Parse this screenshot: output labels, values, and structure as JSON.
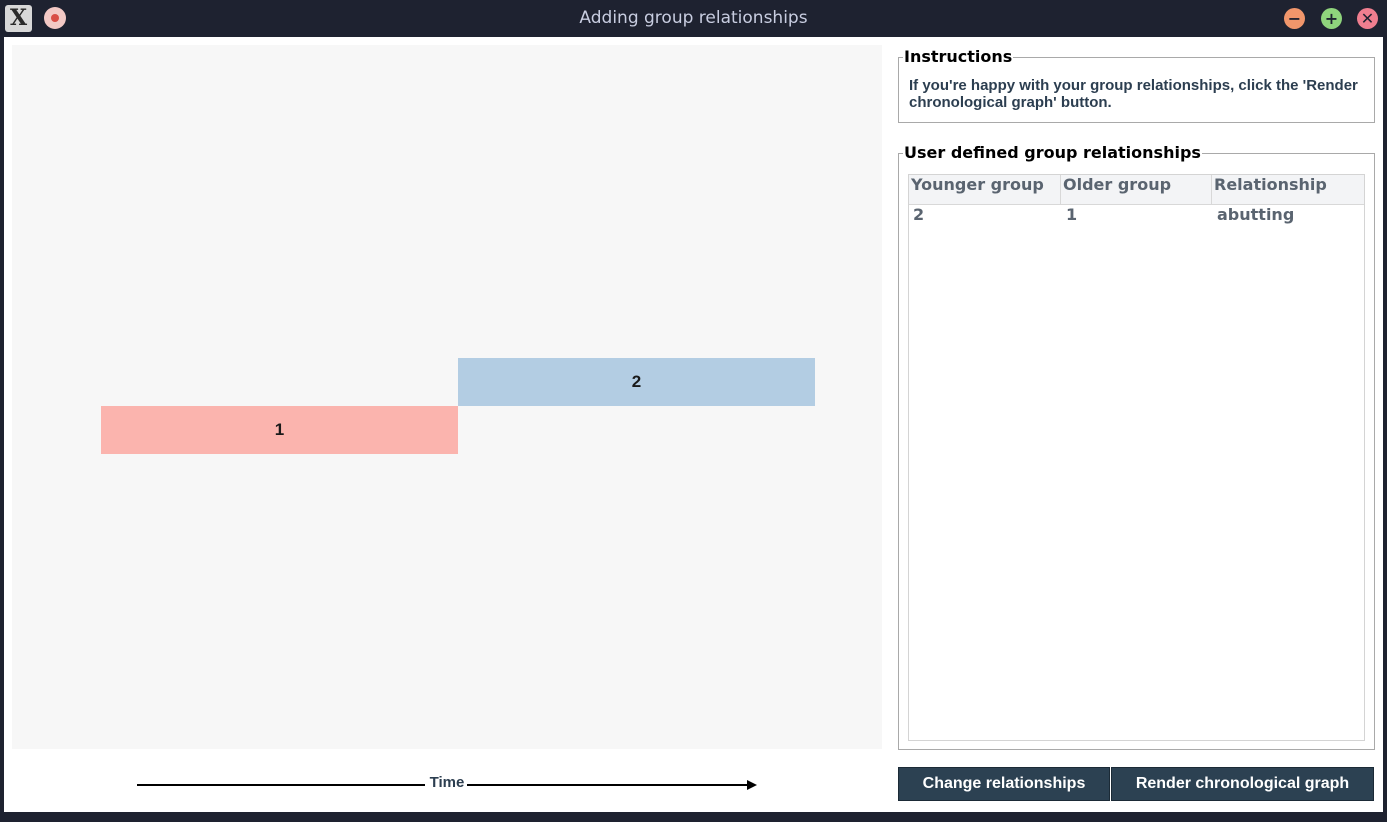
{
  "window": {
    "title": "Adding group relationships"
  },
  "titlebar": {
    "app_icon": "x-app-icon",
    "pin_icon": "pin-icon",
    "minimize_symbol": "−",
    "maximize_symbol": "+",
    "close_symbol": "✕"
  },
  "canvas": {
    "groups": [
      {
        "label": "1",
        "color": "#fbb4ae"
      },
      {
        "label": "2",
        "color": "#b3cde3"
      }
    ],
    "axis_label": "Time"
  },
  "instructions": {
    "title": "Instructions",
    "text": "If you're happy with your group relationships, click the 'Render chronological graph' button."
  },
  "relationships": {
    "title": "User defined group relationships",
    "columns": [
      "Younger group",
      "Older group",
      "Relationship"
    ],
    "rows": [
      [
        "2",
        "1",
        "abutting"
      ]
    ]
  },
  "buttons": {
    "change_label": "Change relationships",
    "render_label": "Render chronological graph",
    "color": "#2c4152"
  }
}
